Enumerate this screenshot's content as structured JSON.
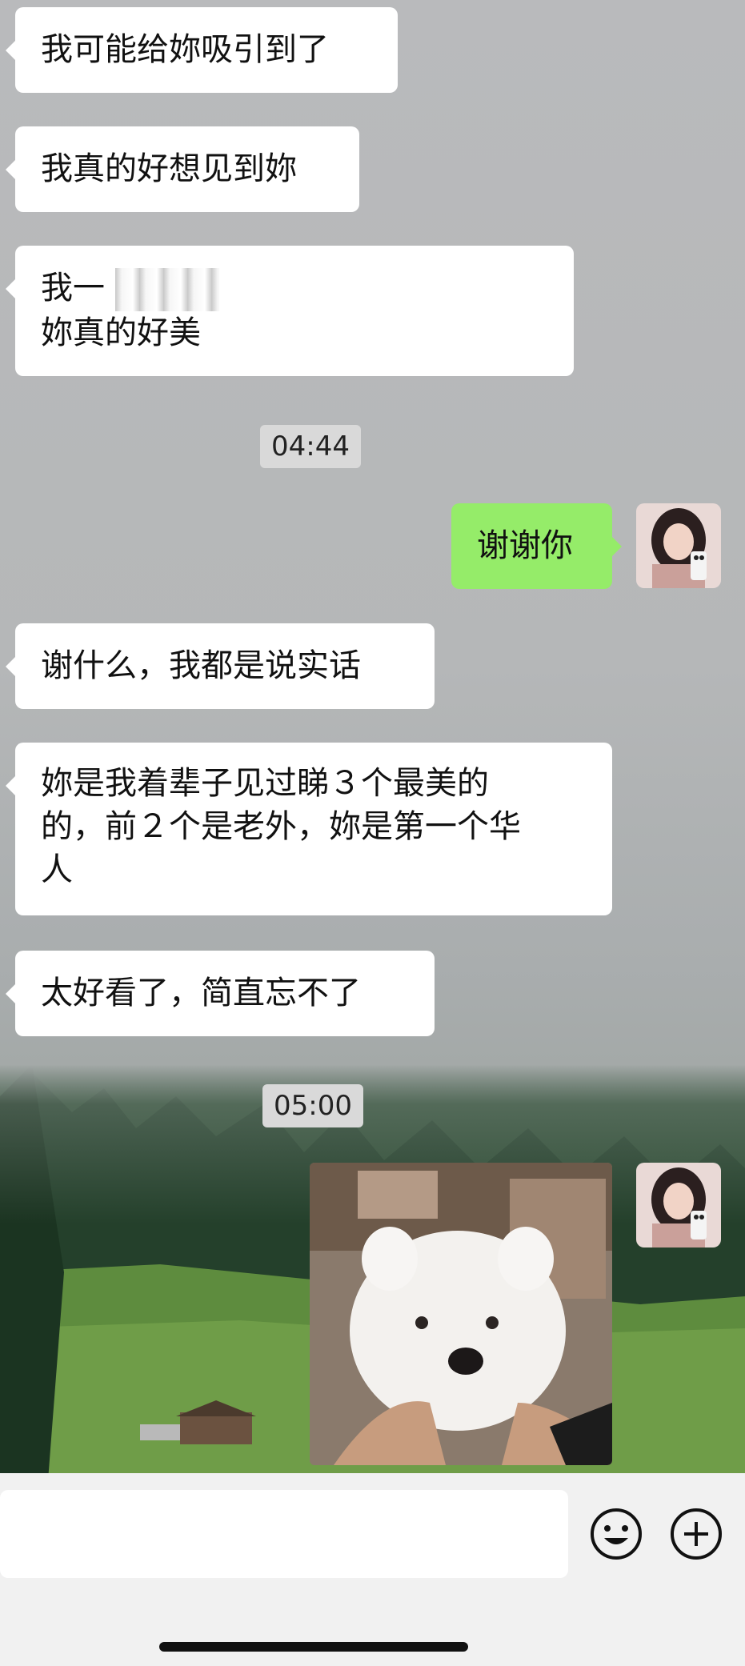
{
  "messages": {
    "m1": "我可能给妳吸引到了",
    "m2": "我真的好想见到妳",
    "m3_line1": "我一",
    "m3_line2": "妳真的好美",
    "ts1": "04:44",
    "m4": "谢谢你",
    "m5": "谢什么，我都是说实话",
    "m6_line1": "妳是我着辈子见过睇３个最美的",
    "m6_line2": "的，前２个是老外，妳是第一个华",
    "m6_line3": "人",
    "m7": "太好看了，简直忘不了",
    "ts2": "05:00"
  },
  "colors": {
    "outgoing_bubble": "#95ec69",
    "incoming_bubble": "#ffffff",
    "timestamp_bg": "#d9d9d9"
  },
  "icons": {
    "emoji": "smiley-face-icon",
    "more": "plus-circle-icon"
  }
}
